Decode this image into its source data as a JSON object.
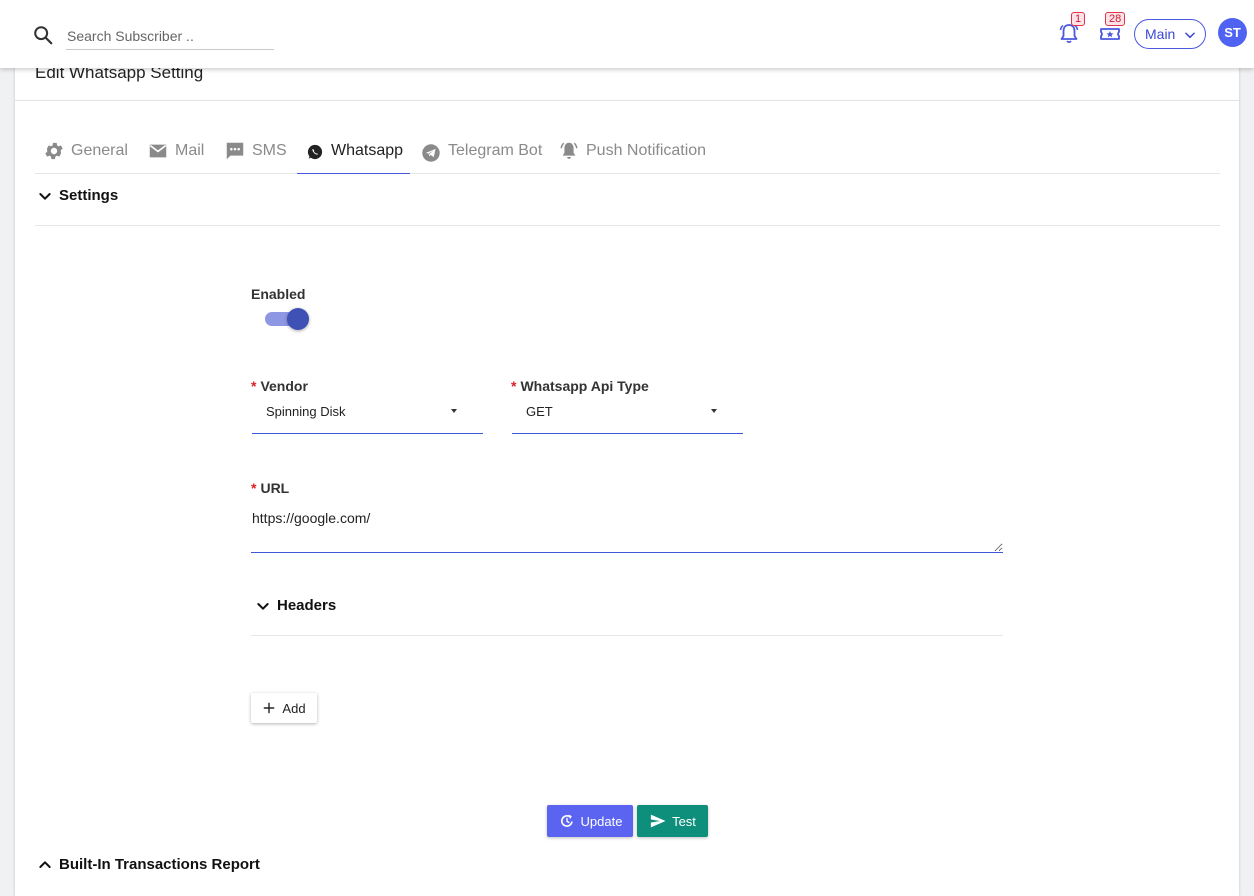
{
  "topbar": {
    "search_placeholder": "Search Subscriber ..",
    "notifications_count": "1",
    "tickets_count": "28",
    "workspace_select": "Main",
    "avatar_initials": "ST"
  },
  "page": {
    "title": "Edit Whatsapp Setting"
  },
  "tabs": [
    {
      "label": "General",
      "icon": "gear-icon"
    },
    {
      "label": "Mail",
      "icon": "mail-icon"
    },
    {
      "label": "SMS",
      "icon": "sms-icon"
    },
    {
      "label": "Whatsapp",
      "icon": "whatsapp-icon",
      "active": true
    },
    {
      "label": "Telegram Bot",
      "icon": "telegram-icon"
    },
    {
      "label": "Push Notification",
      "icon": "bell-icon"
    }
  ],
  "settings": {
    "section_title": "Settings",
    "enabled_label": "Enabled",
    "enabled_value": true,
    "vendor_label": "Vendor",
    "vendor_value": "Spinning Disk",
    "api_type_label": "Whatsapp Api Type",
    "api_type_value": "GET",
    "url_label": "URL",
    "url_value": "https://google.com/",
    "headers_title": "Headers",
    "add_label": "Add"
  },
  "actions": {
    "update_label": "Update",
    "test_label": "Test"
  },
  "footer_section": {
    "title": "Built-In Transactions Report"
  },
  "colors": {
    "accent": "#4a58e0",
    "update_button": "#5b64f1",
    "test_button": "#0e8f7c",
    "required": "#e02020",
    "badge": "#d11a33"
  }
}
